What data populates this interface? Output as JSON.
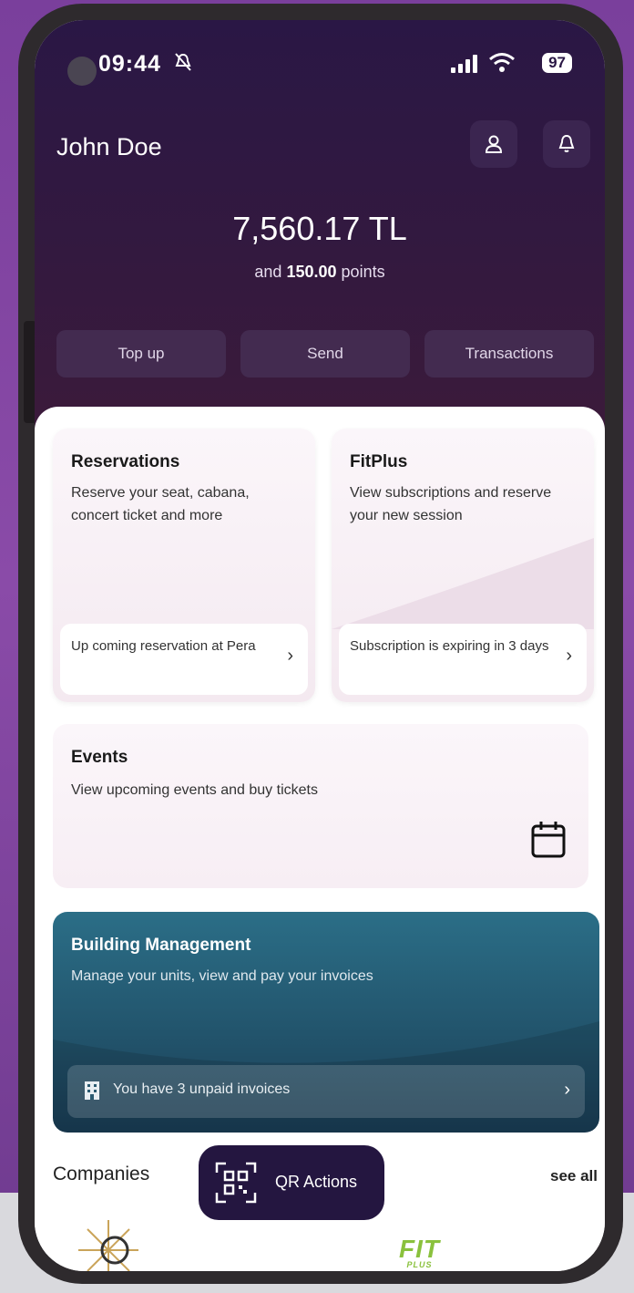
{
  "status_bar": {
    "time": "09:44",
    "battery": "97"
  },
  "header": {
    "user_name": "John Doe",
    "balance": "7,560.17 TL",
    "points_prefix": "and",
    "points_value": "150.00",
    "points_suffix": "points",
    "actions": [
      "Top up",
      "Send",
      "Transactions"
    ]
  },
  "cards": {
    "reservations": {
      "title": "Reservations",
      "description": "Reserve your seat, cabana, concert ticket and more",
      "footer": "Up coming reservation at Pera"
    },
    "fitplus": {
      "title": "FitPlus",
      "description": "View subscriptions and reserve your new session",
      "footer": "Subscription is expiring in 3 days"
    },
    "events": {
      "title": "Events",
      "description": "View upcoming events and buy tickets"
    },
    "building": {
      "title": "Building Management",
      "description": "Manage your units, view and pay your invoices",
      "footer": "You have 3 unpaid invoices"
    }
  },
  "companies": {
    "title": "Companies",
    "see_all": "see all",
    "logo2_text": "FIT",
    "logo2_sub": "PLUS"
  },
  "qr_button": {
    "label": "QR Actions"
  },
  "colors": {
    "header_bg": "#2a1745",
    "building_card": "#2b6e87",
    "qr_bg": "#241640",
    "fit_logo": "#8ac13d"
  }
}
